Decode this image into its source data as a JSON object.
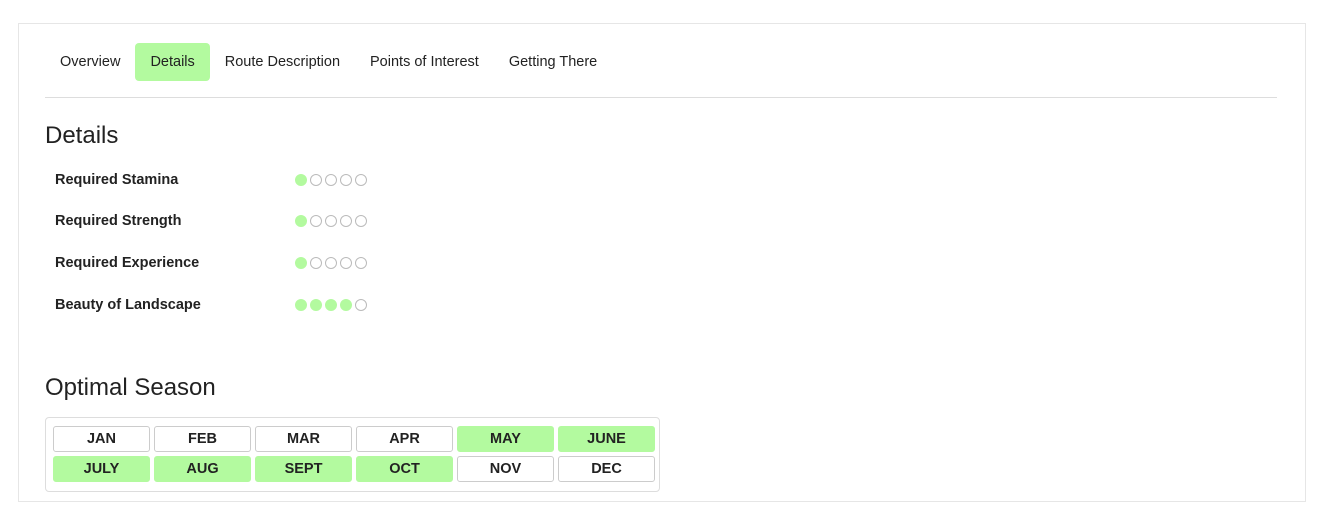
{
  "tabs": [
    {
      "label": "Overview",
      "active": false
    },
    {
      "label": "Details",
      "active": true
    },
    {
      "label": "Route Description",
      "active": false
    },
    {
      "label": "Points of Interest",
      "active": false
    },
    {
      "label": "Getting There",
      "active": false
    }
  ],
  "details": {
    "title": "Details",
    "ratings": [
      {
        "label": "Required Stamina",
        "value": 1,
        "max": 5
      },
      {
        "label": "Required Strength",
        "value": 1,
        "max": 5
      },
      {
        "label": "Required Experience",
        "value": 1,
        "max": 5
      },
      {
        "label": "Beauty of Landscape",
        "value": 4,
        "max": 5
      }
    ]
  },
  "season": {
    "title": "Optimal Season",
    "months": [
      {
        "label": "JAN",
        "active": false
      },
      {
        "label": "FEB",
        "active": false
      },
      {
        "label": "MAR",
        "active": false
      },
      {
        "label": "APR",
        "active": false
      },
      {
        "label": "MAY",
        "active": true
      },
      {
        "label": "JUNE",
        "active": true
      },
      {
        "label": "JULY",
        "active": true
      },
      {
        "label": "AUG",
        "active": true
      },
      {
        "label": "SEPT",
        "active": true
      },
      {
        "label": "OCT",
        "active": true
      },
      {
        "label": "NOV",
        "active": false
      },
      {
        "label": "DEC",
        "active": false
      }
    ]
  },
  "colors": {
    "accent": "#b3fa9f",
    "border": "#dddddd",
    "text": "#222222"
  }
}
